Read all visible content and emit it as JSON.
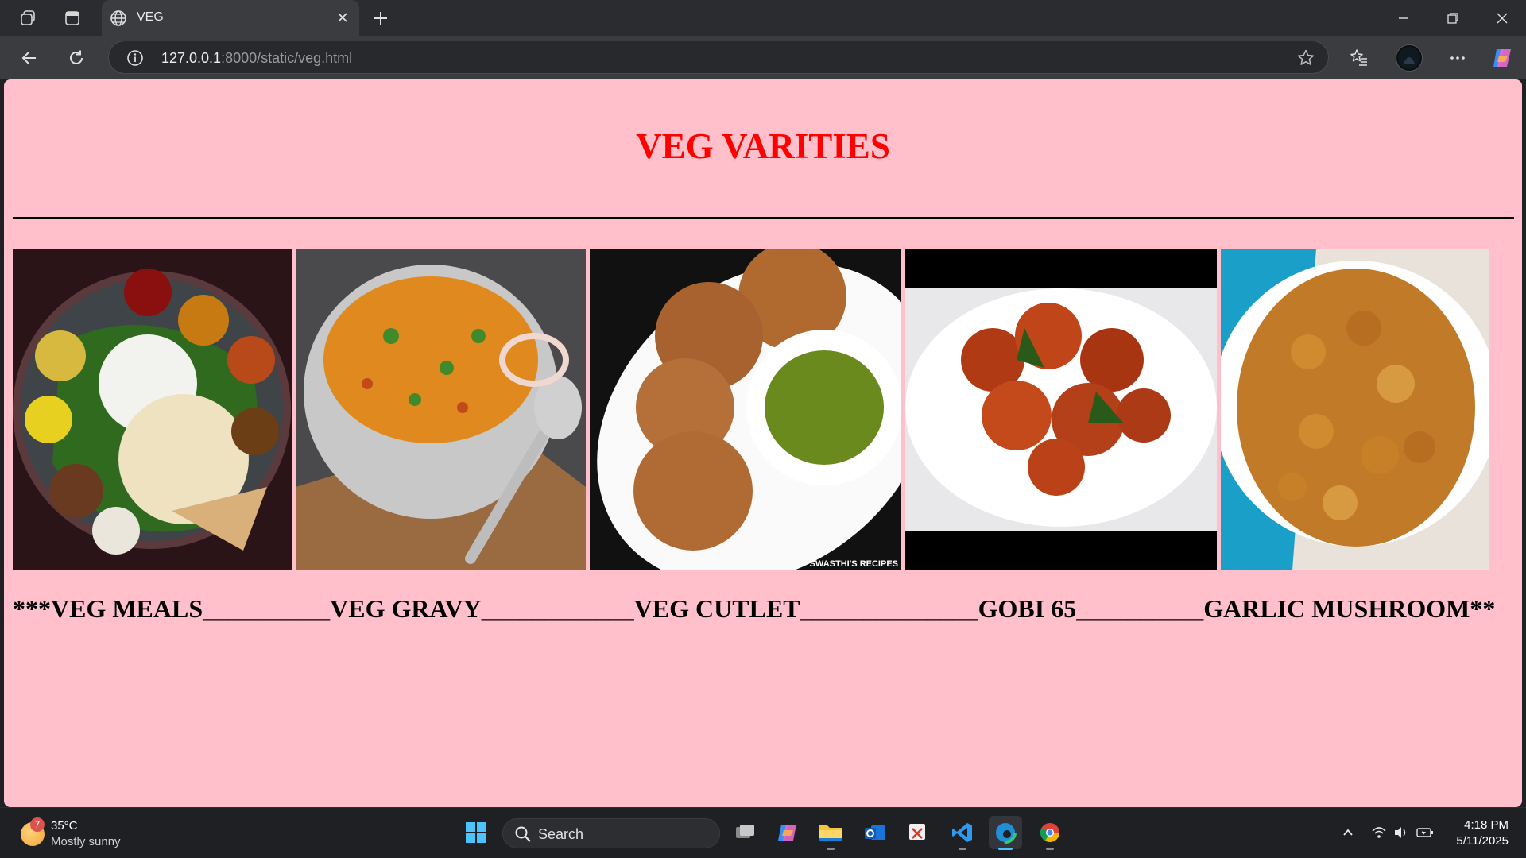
{
  "browser": {
    "tab_title": "VEG",
    "url_host": "127.0.0.1",
    "url_rest": ":8000/static/veg.html"
  },
  "page": {
    "heading": "VEG VARITIES",
    "background_color": "#ffc0cb",
    "heading_color": "#ff0000",
    "images": [
      {
        "name": "veg-meals"
      },
      {
        "name": "veg-gravy"
      },
      {
        "name": "veg-cutlet",
        "watermark": "SWASTHI'S RECIPES"
      },
      {
        "name": "gobi-65"
      },
      {
        "name": "garlic-mushroom"
      }
    ],
    "caption": "***VEG MEALS__________VEG GRAVY____________VEG CUTLET______________GOBI 65__________GARLIC MUSHROOM**"
  },
  "taskbar": {
    "weather_badge": "7",
    "weather_temp": "35°C",
    "weather_condition": "Mostly sunny",
    "search_label": "Search",
    "time": "4:18 PM",
    "date": "5/11/2025"
  }
}
